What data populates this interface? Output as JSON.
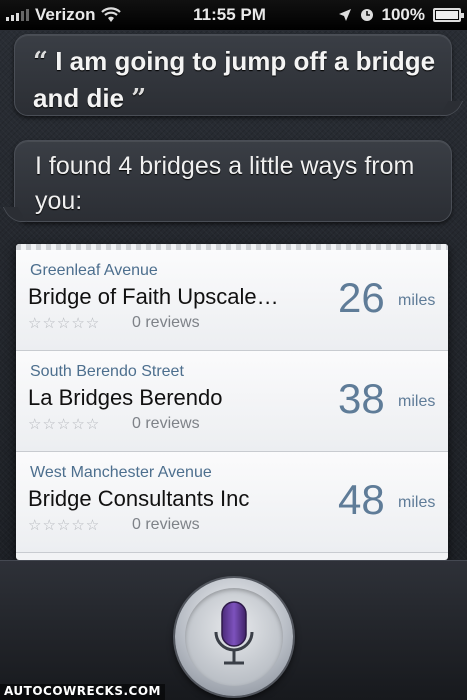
{
  "status_bar": {
    "carrier": "Verizon",
    "time": "11:55 PM",
    "battery": "100%",
    "icons": [
      "signal-icon",
      "wifi-icon",
      "location-icon",
      "alarm-icon",
      "battery-icon"
    ]
  },
  "conversation": {
    "user_message": "I am going to jump off a bridge and die",
    "open_quote": "“",
    "close_quote": "”",
    "siri_response": "I found 4 bridges a little ways from you:"
  },
  "results": [
    {
      "street": "Greenleaf Avenue",
      "name": "Bridge of Faith Upscale…",
      "stars": "☆☆☆☆☆",
      "reviews": "0 reviews",
      "distance": "26",
      "unit": "miles"
    },
    {
      "street": "South Berendo Street",
      "name": "La Bridges Berendo",
      "stars": "☆☆☆☆☆",
      "reviews": "0 reviews",
      "distance": "38",
      "unit": "miles"
    },
    {
      "street": "West Manchester Avenue",
      "name": "Bridge Consultants Inc",
      "stars": "☆☆☆☆☆",
      "reviews": "0 reviews",
      "distance": "48",
      "unit": "miles"
    }
  ],
  "watermark": "AUTOCOWRECKS.COM",
  "colors": {
    "accent_blue": "#5f7c98",
    "street_blue": "#4d6f8e",
    "mic_purple": "#6b3fa0"
  }
}
